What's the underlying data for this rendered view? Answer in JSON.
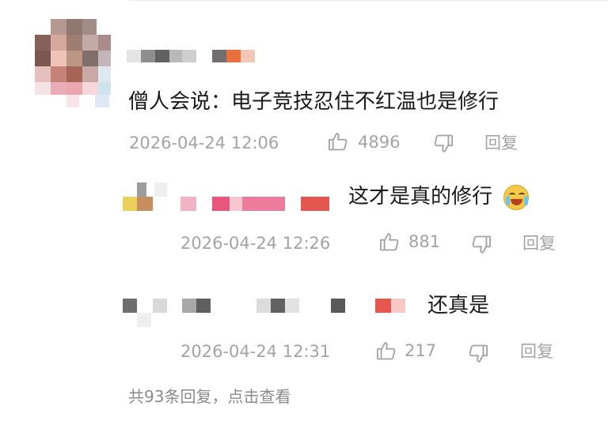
{
  "colors": {
    "text": "#1a1a1a",
    "meta": "#a3a3a3",
    "background": "#ffffff"
  },
  "main_comment": {
    "username": "",
    "text": "僧人会说：电子竞技忍住不红温也是修行",
    "timestamp": "2026-04-24 12:06",
    "like_count": "4896",
    "reply_label": "回复"
  },
  "replies": [
    {
      "username": "",
      "text": "这才是真的修行",
      "emoji": "laugh-cry-emoji",
      "timestamp": "2026-04-24 12:26",
      "like_count": "881",
      "reply_label": "回复"
    },
    {
      "username": "",
      "text": "还真是",
      "timestamp": "2026-04-24 12:31",
      "like_count": "217",
      "reply_label": "回复"
    }
  ],
  "more_replies_link": "共93条回复，点击查看",
  "icons": [
    "thumbs-up-icon",
    "thumbs-down-icon"
  ]
}
